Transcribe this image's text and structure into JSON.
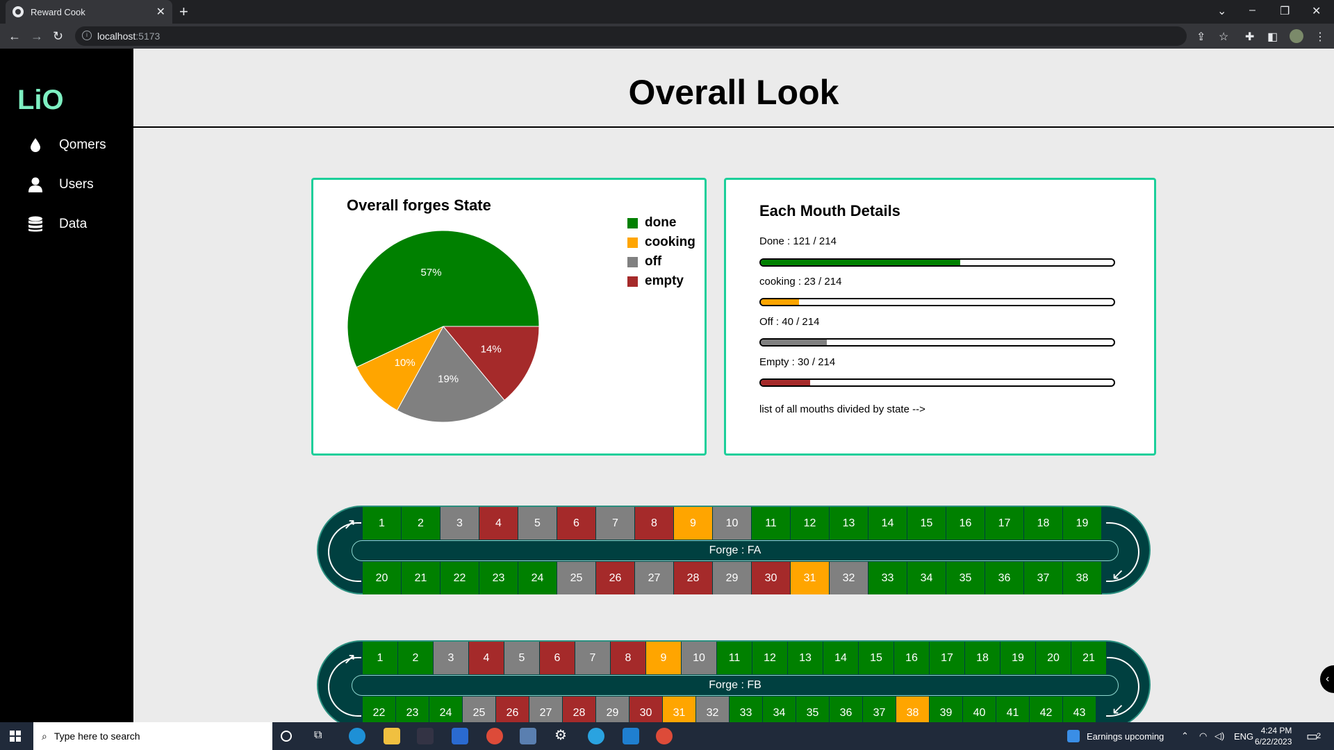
{
  "browser": {
    "tab_title": "Reward Cook",
    "tab_close": "✕",
    "new_tab": "+",
    "url_host": "localhost",
    "url_port": ":5173"
  },
  "sidebar": {
    "logo": "LiO",
    "items": [
      {
        "label": "Qomers",
        "icon": "drop-icon"
      },
      {
        "label": "Users",
        "icon": "user-icon"
      },
      {
        "label": "Data",
        "icon": "database-icon"
      }
    ]
  },
  "main": {
    "title": "Overall Look"
  },
  "colors": {
    "done": "#008000",
    "cooking": "#ffa500",
    "off": "#808080",
    "empty": "#a52a2a",
    "accent": "#1ccf9a",
    "forge_bg": "#004040"
  },
  "chart_data": {
    "type": "pie",
    "title": "Overall forges State",
    "slices": [
      {
        "name": "done",
        "value": 57,
        "label": "57%"
      },
      {
        "name": "empty",
        "value": 14,
        "label": "14%"
      },
      {
        "name": "off",
        "value": 19,
        "label": "19%"
      },
      {
        "name": "cooking",
        "value": 10,
        "label": "10%"
      }
    ],
    "legend": [
      "done",
      "cooking",
      "off",
      "empty"
    ],
    "legend_position": "top-right"
  },
  "details": {
    "title": "Each Mouth Details",
    "stats": [
      {
        "label": "Done : 121 / 214",
        "value": 121,
        "total": 214,
        "state": "done"
      },
      {
        "label": "cooking : 23 / 214",
        "value": 23,
        "total": 214,
        "state": "cooking"
      },
      {
        "label": "Off : 40 / 214",
        "value": 40,
        "total": 214,
        "state": "off"
      },
      {
        "label": "Empty : 30 / 214",
        "value": 30,
        "total": 214,
        "state": "empty"
      }
    ],
    "footnote": "list of all mouths divided by state -->"
  },
  "forges": [
    {
      "label": "Forge : FA",
      "top": [
        {
          "n": "1",
          "s": "done"
        },
        {
          "n": "2",
          "s": "done"
        },
        {
          "n": "3",
          "s": "off"
        },
        {
          "n": "4",
          "s": "empty"
        },
        {
          "n": "5",
          "s": "off"
        },
        {
          "n": "6",
          "s": "empty"
        },
        {
          "n": "7",
          "s": "off"
        },
        {
          "n": "8",
          "s": "empty"
        },
        {
          "n": "9",
          "s": "cooking"
        },
        {
          "n": "10",
          "s": "off"
        },
        {
          "n": "11",
          "s": "done"
        },
        {
          "n": "12",
          "s": "done"
        },
        {
          "n": "13",
          "s": "done"
        },
        {
          "n": "14",
          "s": "done"
        },
        {
          "n": "15",
          "s": "done"
        },
        {
          "n": "16",
          "s": "done"
        },
        {
          "n": "17",
          "s": "done"
        },
        {
          "n": "18",
          "s": "done"
        },
        {
          "n": "19",
          "s": "done"
        }
      ],
      "bottom": [
        {
          "n": "20",
          "s": "done"
        },
        {
          "n": "21",
          "s": "done"
        },
        {
          "n": "22",
          "s": "done"
        },
        {
          "n": "23",
          "s": "done"
        },
        {
          "n": "24",
          "s": "done"
        },
        {
          "n": "25",
          "s": "off"
        },
        {
          "n": "26",
          "s": "empty"
        },
        {
          "n": "27",
          "s": "off"
        },
        {
          "n": "28",
          "s": "empty"
        },
        {
          "n": "29",
          "s": "off"
        },
        {
          "n": "30",
          "s": "empty"
        },
        {
          "n": "31",
          "s": "cooking"
        },
        {
          "n": "32",
          "s": "off"
        },
        {
          "n": "33",
          "s": "done"
        },
        {
          "n": "34",
          "s": "done"
        },
        {
          "n": "35",
          "s": "done"
        },
        {
          "n": "36",
          "s": "done"
        },
        {
          "n": "37",
          "s": "done"
        },
        {
          "n": "38",
          "s": "done"
        }
      ]
    },
    {
      "label": "Forge : FB",
      "top": [
        {
          "n": "1",
          "s": "done"
        },
        {
          "n": "2",
          "s": "done"
        },
        {
          "n": "3",
          "s": "off"
        },
        {
          "n": "4",
          "s": "empty"
        },
        {
          "n": "5",
          "s": "off"
        },
        {
          "n": "6",
          "s": "empty"
        },
        {
          "n": "7",
          "s": "off"
        },
        {
          "n": "8",
          "s": "empty"
        },
        {
          "n": "9",
          "s": "cooking"
        },
        {
          "n": "10",
          "s": "off"
        },
        {
          "n": "11",
          "s": "done"
        },
        {
          "n": "12",
          "s": "done"
        },
        {
          "n": "13",
          "s": "done"
        },
        {
          "n": "14",
          "s": "done"
        },
        {
          "n": "15",
          "s": "done"
        },
        {
          "n": "16",
          "s": "done"
        },
        {
          "n": "17",
          "s": "done"
        },
        {
          "n": "18",
          "s": "done"
        },
        {
          "n": "19",
          "s": "done"
        },
        {
          "n": "20",
          "s": "done"
        },
        {
          "n": "21",
          "s": "done"
        }
      ],
      "bottom": [
        {
          "n": "22",
          "s": "done"
        },
        {
          "n": "23",
          "s": "done"
        },
        {
          "n": "24",
          "s": "done"
        },
        {
          "n": "25",
          "s": "off"
        },
        {
          "n": "26",
          "s": "empty"
        },
        {
          "n": "27",
          "s": "off"
        },
        {
          "n": "28",
          "s": "empty"
        },
        {
          "n": "29",
          "s": "off"
        },
        {
          "n": "30",
          "s": "empty"
        },
        {
          "n": "31",
          "s": "cooking"
        },
        {
          "n": "32",
          "s": "off"
        },
        {
          "n": "33",
          "s": "done"
        },
        {
          "n": "34",
          "s": "done"
        },
        {
          "n": "35",
          "s": "done"
        },
        {
          "n": "36",
          "s": "done"
        },
        {
          "n": "37",
          "s": "done"
        },
        {
          "n": "38",
          "s": "cooking"
        },
        {
          "n": "39",
          "s": "done"
        },
        {
          "n": "40",
          "s": "done"
        },
        {
          "n": "41",
          "s": "done"
        },
        {
          "n": "42",
          "s": "done"
        },
        {
          "n": "43",
          "s": "done"
        }
      ]
    }
  ],
  "taskbar": {
    "search_placeholder": "Type here to search",
    "news": "Earnings upcoming",
    "lang": "ENG",
    "time": "4:24 PM",
    "date": "6/22/2023",
    "notif_count": "2"
  }
}
